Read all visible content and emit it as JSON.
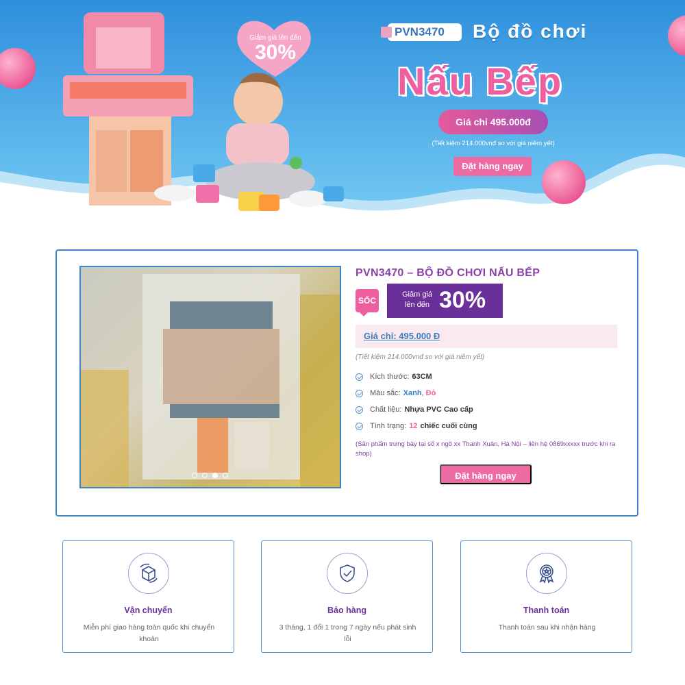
{
  "hero": {
    "sku": "PVN3470",
    "title_line1": "Bộ đồ chơi",
    "title_line2": "Nấu Bếp",
    "price_pill": "Giá chỉ 495.000đ",
    "savings_note": "(Tiết kiệm 214.000vnđ so với giá niêm yết)",
    "order_button": "Đặt hàng ngay",
    "heart_label": "Giảm giá lên đến",
    "heart_percent": "30%"
  },
  "product": {
    "title": "PVN3470 – BỘ ĐỒ CHƠI NẤU BẾP",
    "badge": "SỐC",
    "discount_label": "Giảm giá lên đến",
    "discount_percent": "30%",
    "price": "Giá chỉ: 495.000 Đ",
    "savings_note": "(Tiết kiệm 214.000vnđ so với giá niêm yết)",
    "specs": [
      {
        "label": "Kích thước:",
        "value": "63CM"
      },
      {
        "label": "Màu sắc:",
        "value_blue": "Xanh",
        "sep": ",",
        "value_pink": "Đỏ"
      },
      {
        "label": "Chất liệu:",
        "value": "Nhựa PVC Cao cấp"
      },
      {
        "label": "Tình trạng:",
        "value_pink": "12",
        "value": "chiếc cuối cùng"
      }
    ],
    "note": "(Sản phẩm trưng bày tại số x ngõ xx Thanh Xuân, Hà Nội – liên hệ 0869xxxxx trước khi ra shop)",
    "order_button": "Đặt hàng ngay",
    "gallery_dots": 4,
    "gallery_active_dot": 3
  },
  "features": [
    {
      "icon": "shipping-box-icon",
      "title": "Vận chuyển",
      "desc": "Miễn phí giao hàng toàn quốc khi chuyển khoản"
    },
    {
      "icon": "shield-check-icon",
      "title": "Bảo hàng",
      "desc": "3 tháng, 1 đổi 1 trong 7 ngày nếu phát sinh lỗi"
    },
    {
      "icon": "award-badge-icon",
      "title": "Thanh toán",
      "desc": "Thanh toán sau khi nhận hàng"
    }
  ],
  "colors": {
    "hero_blue": "#3a9fe0",
    "pink": "#ee6aa2",
    "purple": "#6b2f9a",
    "border_blue": "#3f86c8"
  }
}
